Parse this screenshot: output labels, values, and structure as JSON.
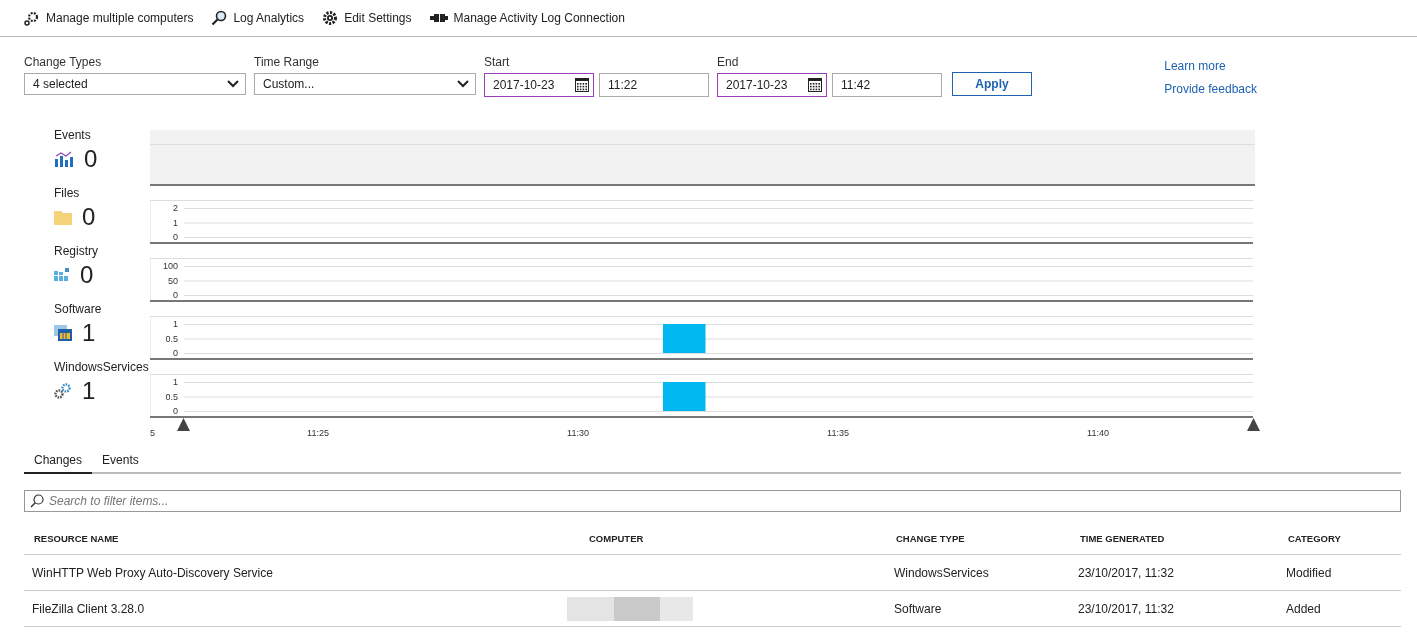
{
  "toolbar": [
    {
      "label": "Manage multiple computers",
      "kind": "computers"
    },
    {
      "label": "Log Analytics",
      "kind": "analytics"
    },
    {
      "label": "Edit Settings",
      "kind": "settings"
    },
    {
      "label": "Manage Activity Log Connection",
      "kind": "connection"
    }
  ],
  "filters": {
    "change_types": {
      "label": "Change Types",
      "value": "4 selected"
    },
    "time_range": {
      "label": "Time Range",
      "value": "Custom..."
    },
    "start": {
      "label": "Start",
      "date": "2017-10-23",
      "time": "11:22"
    },
    "end": {
      "label": "End",
      "date": "2017-10-23",
      "time": "11:42"
    },
    "apply": "Apply"
  },
  "links": [
    "Learn more",
    "Provide feedback"
  ],
  "summary": [
    {
      "kind": "events",
      "label": "Events",
      "count": "0"
    },
    {
      "kind": "files",
      "label": "Files",
      "count": "0",
      "chart_data": {
        "type": "bar",
        "categories": [
          null,
          null,
          null,
          null,
          null,
          null,
          null,
          null,
          null,
          null,
          null,
          null,
          null,
          null,
          null,
          null,
          null,
          null,
          null,
          null,
          null,
          null,
          null,
          null,
          null,
          null
        ],
        "values": [
          0,
          0,
          0,
          0,
          0,
          0,
          0,
          0,
          0,
          0,
          0,
          0,
          0,
          0,
          0,
          0,
          0,
          0,
          0,
          0,
          0,
          0,
          0,
          0,
          0,
          0
        ],
        "ylim": [
          0,
          2
        ],
        "yticks": [
          0,
          1,
          2
        ]
      }
    },
    {
      "kind": "registry",
      "label": "Registry",
      "count": "0",
      "chart_data": {
        "type": "bar",
        "categories": [
          null,
          null,
          null,
          null,
          null,
          null,
          null,
          null,
          null,
          null,
          null,
          null,
          null,
          null,
          null,
          null,
          null,
          null,
          null,
          null,
          null,
          null,
          null,
          null,
          null,
          null
        ],
        "values": [
          0,
          0,
          0,
          0,
          0,
          0,
          0,
          0,
          0,
          0,
          0,
          0,
          0,
          0,
          0,
          0,
          0,
          0,
          0,
          0,
          0,
          0,
          0,
          0,
          0,
          0
        ],
        "ylim": [
          0,
          100
        ],
        "yticks": [
          0,
          50,
          100
        ]
      }
    },
    {
      "kind": "software",
      "label": "Software",
      "count": "1",
      "chart_data": {
        "type": "bar",
        "categories": [
          null,
          null,
          null,
          null,
          null,
          null,
          null,
          null,
          null,
          null,
          null,
          null,
          null,
          null,
          null,
          null,
          null,
          null,
          null,
          null,
          null,
          null,
          null,
          null,
          null,
          null
        ],
        "values": [
          0,
          0,
          0,
          0,
          0,
          0,
          0,
          0,
          0,
          0,
          0,
          0,
          1,
          0,
          0,
          0,
          0,
          0,
          0,
          0,
          0,
          0,
          0,
          0,
          0,
          0
        ],
        "ylim": [
          0,
          1
        ],
        "yticks": [
          0,
          0.5,
          1
        ]
      }
    },
    {
      "kind": "services",
      "label": "WindowsServices",
      "count": "1",
      "chart_data": {
        "type": "bar",
        "categories": [
          null,
          null,
          null,
          null,
          null,
          null,
          null,
          null,
          null,
          null,
          null,
          null,
          null,
          null,
          null,
          null,
          null,
          null,
          null,
          null,
          null,
          null,
          null,
          null,
          null,
          null
        ],
        "values": [
          0,
          0,
          0,
          0,
          0,
          0,
          0,
          0,
          0,
          0,
          0,
          0,
          1,
          0,
          0,
          0,
          0,
          0,
          0,
          0,
          0,
          0,
          0,
          0,
          0,
          0
        ],
        "ylim": [
          0,
          1
        ],
        "yticks": [
          0,
          0.5,
          1
        ]
      }
    }
  ],
  "time_axis": {
    "labels": [
      "5",
      "11:25",
      "11:30",
      "11:35",
      "11:40"
    ]
  },
  "tabs": [
    {
      "label": "Changes",
      "selected": true
    },
    {
      "label": "Events",
      "selected": false
    }
  ],
  "search": {
    "placeholder": "Search to filter items..."
  },
  "table": {
    "columns": [
      "RESOURCE NAME",
      "COMPUTER",
      "CHANGE TYPE",
      "TIME GENERATED",
      "CATEGORY"
    ],
    "rows": [
      {
        "resource": "WinHTTP Web Proxy Auto-Discovery Service",
        "computer_hidden": false,
        "change_type": "WindowsServices",
        "time": "23/10/2017, 11:32",
        "category": "Modified"
      },
      {
        "resource": "FileZilla Client 3.28.0",
        "computer_hidden": true,
        "change_type": "Software",
        "time": "23/10/2017, 11:32",
        "category": "Added"
      }
    ]
  }
}
